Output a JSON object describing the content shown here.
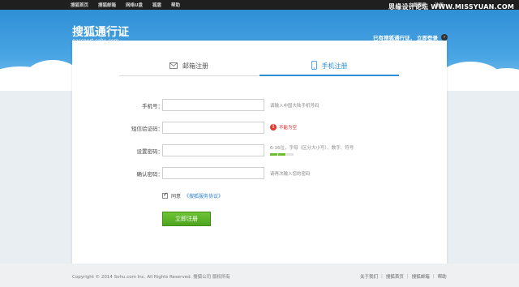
{
  "topbar": {
    "left_links": [
      "搜狐首页",
      "搜狐邮箱",
      "网络U盘",
      "狐盾",
      "帮助"
    ],
    "right_links": [
      "立即登录",
      "注册"
    ]
  },
  "watermark": "思缘设计论坛 WWW.MISSYUAN.COM",
  "header": {
    "logo_title": "搜狐通行证",
    "logo_sub": "passport.sohu.com",
    "login_prompt": "已有搜狐通行证，",
    "login_link": "立即登录"
  },
  "tabs": {
    "email": "邮箱注册",
    "mobile": "手机注册"
  },
  "form": {
    "phone": {
      "label": "手机号：",
      "hint": "请输入中国大陆手机号码"
    },
    "sms": {
      "label": "短信验证码：",
      "error": "不能为空"
    },
    "password": {
      "label": "设置密码：",
      "hint": "6-16位，字母（区分大小写）、数字、符号"
    },
    "confirm": {
      "label": "确认密码：",
      "hint": "请再次输入您的密码"
    },
    "agree_text": "同意",
    "agree_link": "《搜狐服务协议》",
    "submit_label": "立即注册",
    "password_strength": 2
  },
  "footer": {
    "copyright": "Copyright © 2014 Sohu.com Inc. All Rights Reserved. 搜狐公司 版权所有",
    "links": [
      "关于我们",
      "搜狐首页",
      "搜狐邮箱",
      "帮助"
    ]
  },
  "colors": {
    "accent": "#2b8fd6",
    "submit": "#5bb52a",
    "error": "#e23a2e"
  }
}
